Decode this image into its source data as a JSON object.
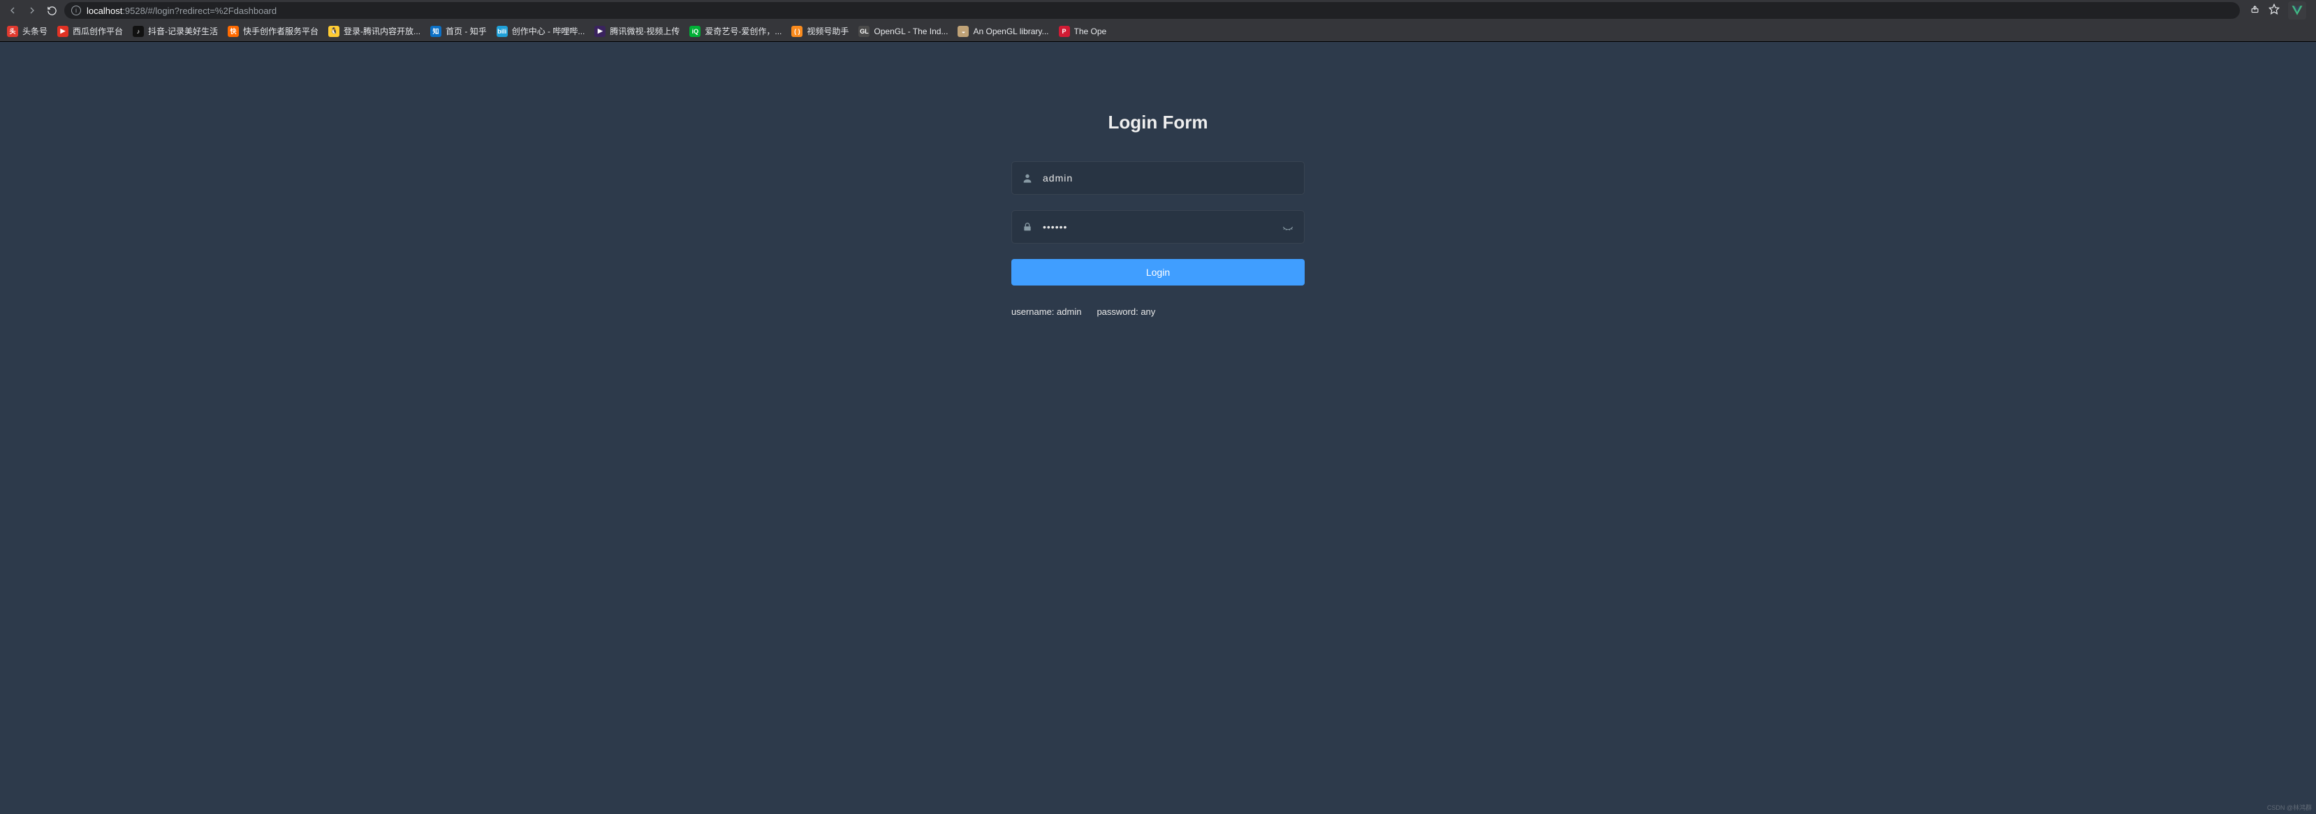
{
  "browser": {
    "url_host": "localhost",
    "url_rest": ":9528/#/login?redirect=%2Fdashboard"
  },
  "bookmarks": [
    {
      "label": "头条号",
      "bg": "#e13a2f",
      "glyph": "头"
    },
    {
      "label": "西瓜创作平台",
      "bg": "#e03224",
      "glyph": "▶"
    },
    {
      "label": "抖音-记录美好生活",
      "bg": "#111111",
      "glyph": "♪"
    },
    {
      "label": "快手创作者服务平台",
      "bg": "#ff6a00",
      "glyph": "快"
    },
    {
      "label": "登录-腾讯内容开放...",
      "bg": "#ffcc33",
      "glyph": "🐧"
    },
    {
      "label": "首页 - 知乎",
      "bg": "#0b70c6",
      "glyph": "知"
    },
    {
      "label": "创作中心 - 哔哩哔...",
      "bg": "#1fa0d8",
      "glyph": "bili"
    },
    {
      "label": "腾讯微视·视频上传",
      "bg": "#3a235e",
      "glyph": "▶"
    },
    {
      "label": "爱奇艺号-爱创作，...",
      "bg": "#00b036",
      "glyph": "iQ"
    },
    {
      "label": "视频号助手",
      "bg": "#fa8b1d",
      "glyph": "( )"
    },
    {
      "label": "OpenGL - The Ind...",
      "bg": "#4a4a4a",
      "glyph": "GL"
    },
    {
      "label": "An OpenGL library...",
      "bg": "#bfa277",
      "glyph": "◒"
    },
    {
      "label": "The Ope",
      "bg": "#d11b34",
      "glyph": "P"
    }
  ],
  "login": {
    "title": "Login Form",
    "username_value": "admin",
    "password_value": "111111",
    "button_label": "Login"
  },
  "tips": {
    "username": "username: admin",
    "password": "password: any"
  },
  "watermark": "CSDN @林鸿群"
}
